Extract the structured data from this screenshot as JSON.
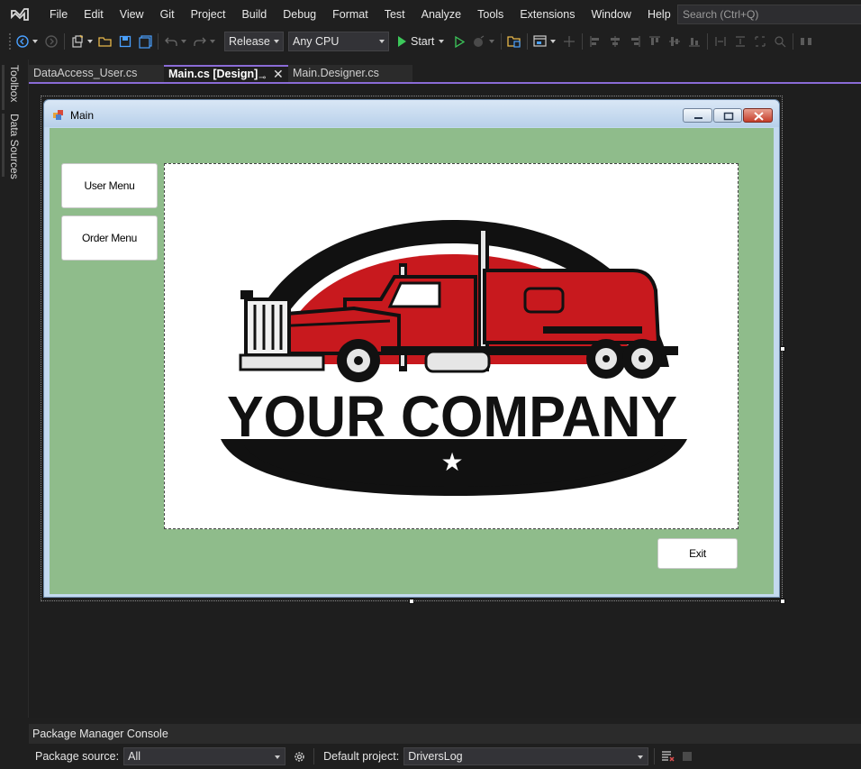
{
  "menubar": {
    "items": [
      "File",
      "Edit",
      "View",
      "Git",
      "Project",
      "Build",
      "Debug",
      "Format",
      "Test",
      "Analyze",
      "Tools",
      "Extensions",
      "Window",
      "Help"
    ],
    "search_placeholder": "Search (Ctrl+Q)"
  },
  "toolbar": {
    "configuration": "Release",
    "platform": "Any CPU",
    "start_label": "Start"
  },
  "side_tabs": [
    "Toolbox",
    "Data Sources"
  ],
  "doc_tabs": [
    {
      "label": "DataAccess_User.cs",
      "active": false
    },
    {
      "label": "Main.cs [Design]",
      "active": true
    },
    {
      "label": "Main.Designer.cs",
      "active": false
    }
  ],
  "form": {
    "title": "Main",
    "back_color": "#8fbc8b",
    "buttons": {
      "user_menu": "User Menu",
      "order_menu": "Order Menu",
      "exit": "Exit"
    },
    "logo": {
      "text": "YOUR COMPANY",
      "star": "★"
    }
  },
  "pmc": {
    "title": "Package Manager Console",
    "package_source_label": "Package source:",
    "package_source_value": "All",
    "default_project_label": "Default project:",
    "default_project_value": "DriversLog"
  },
  "colors": {
    "accent": "#8a6bd6",
    "ide_background": "#1f1f1f",
    "logo_red": "#c8191e"
  }
}
